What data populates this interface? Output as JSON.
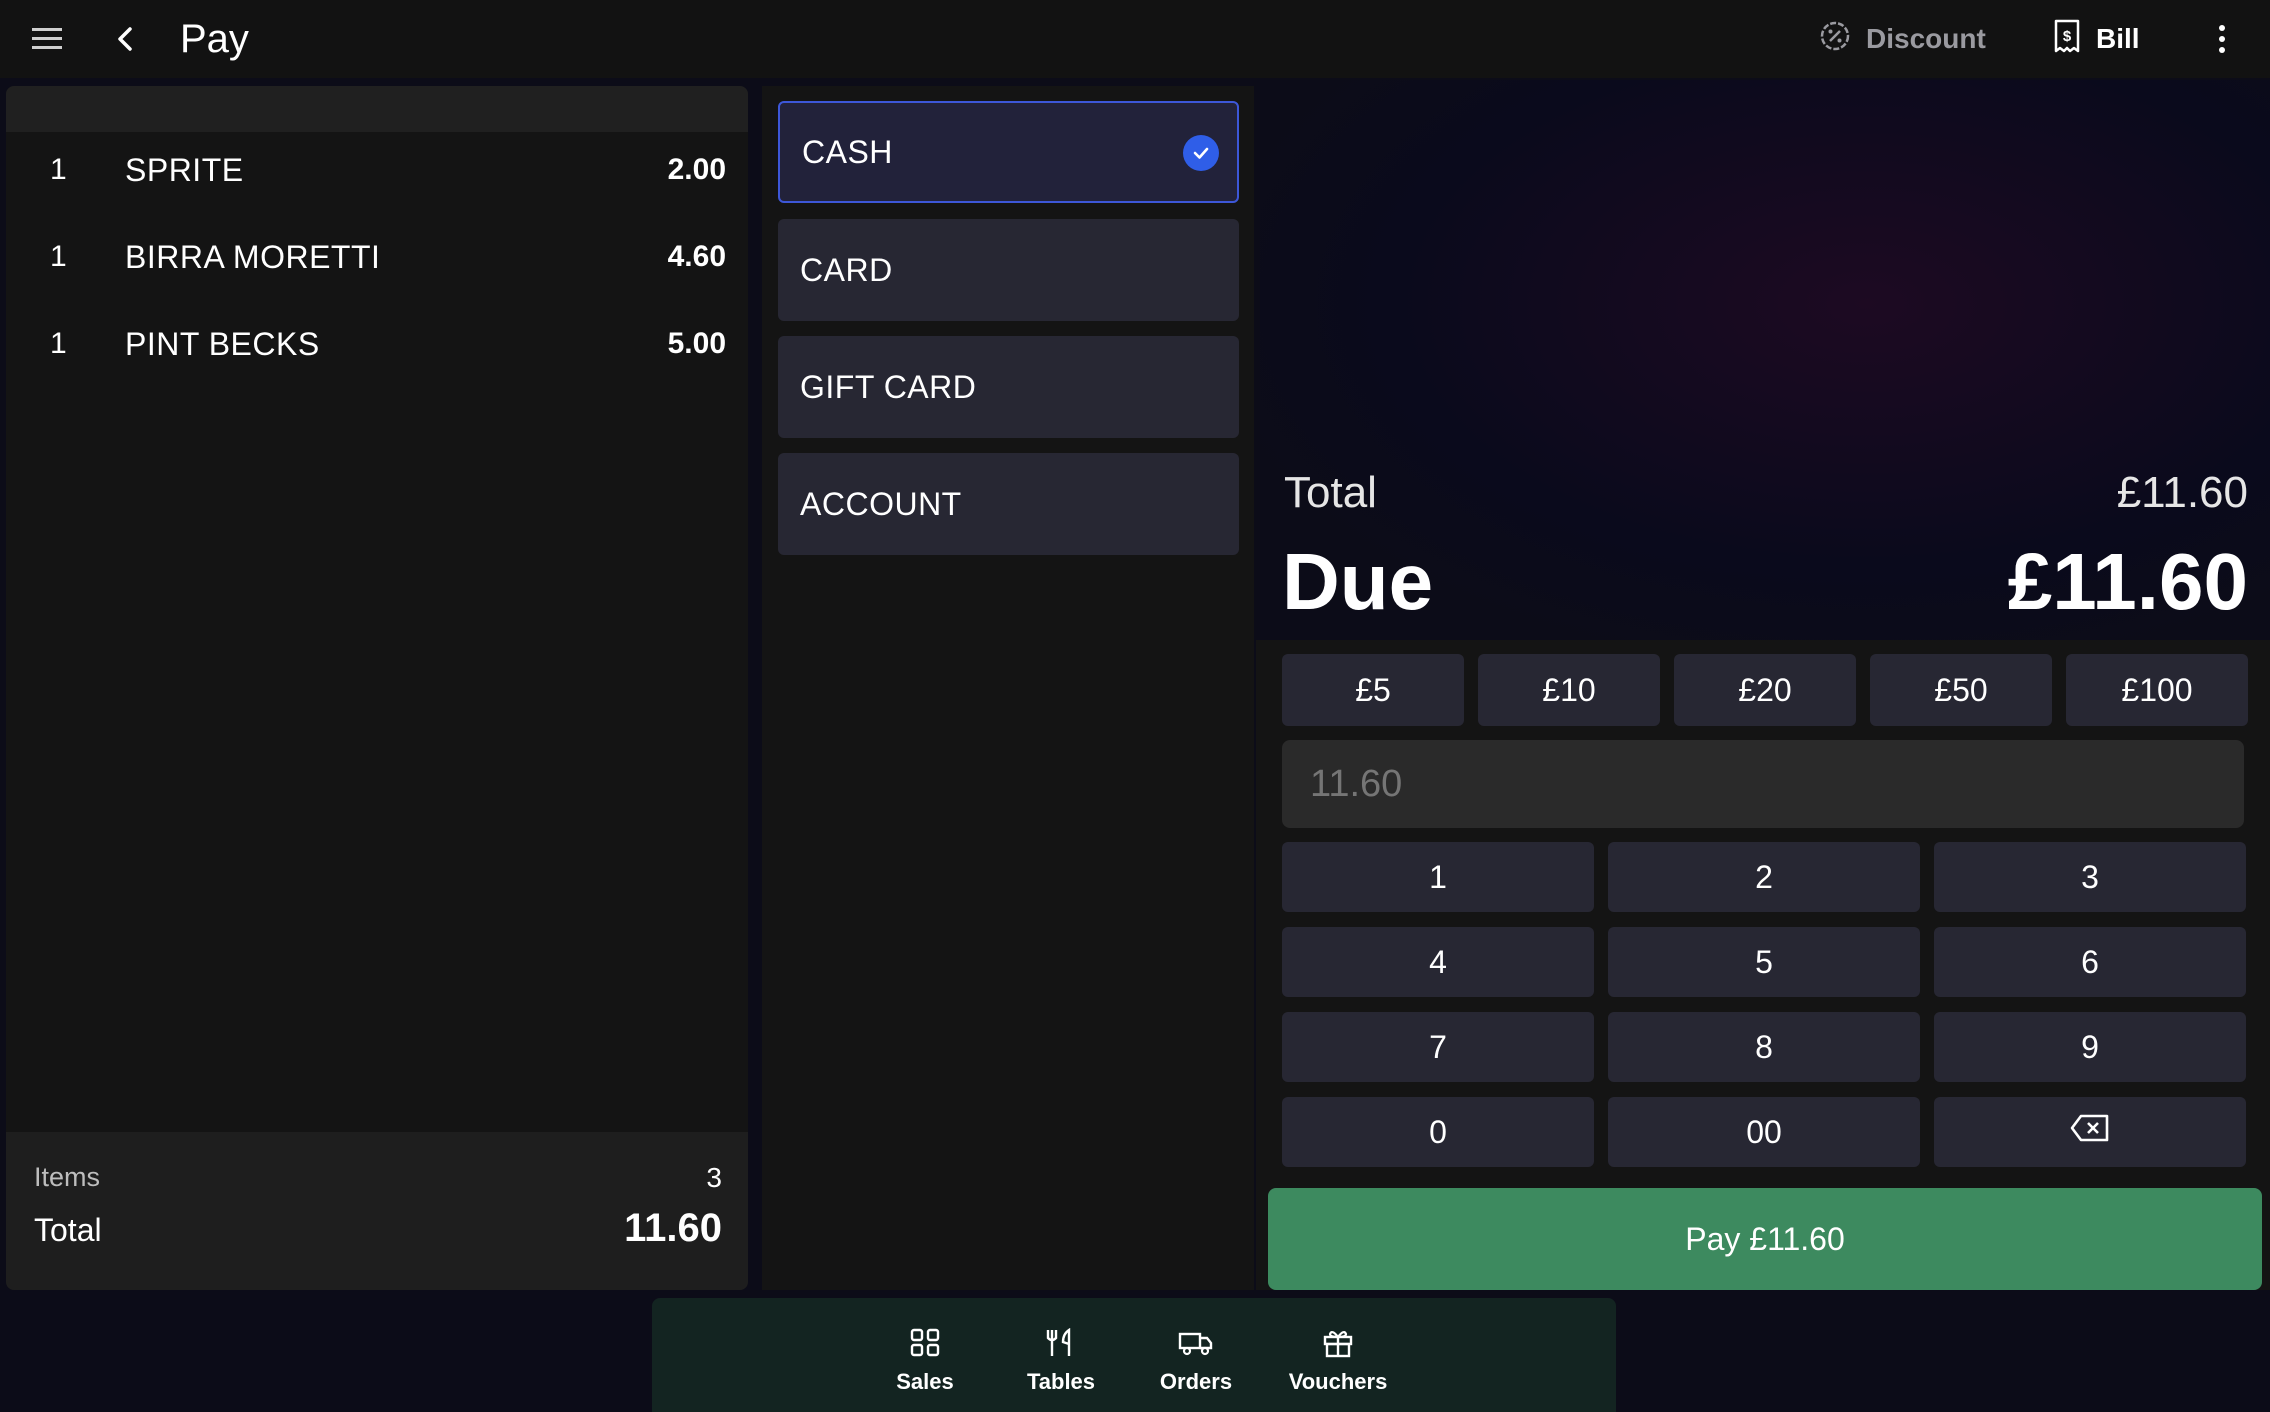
{
  "header": {
    "title": "Pay",
    "discount_label": "Discount",
    "bill_label": "Bill"
  },
  "order": {
    "lines": [
      {
        "qty": "1",
        "name": "SPRITE",
        "price": "2.00"
      },
      {
        "qty": "1",
        "name": "BIRRA MORETTI",
        "price": "4.60"
      },
      {
        "qty": "1",
        "name": "PINT BECKS",
        "price": "5.00"
      }
    ],
    "items_label": "Items",
    "items_count": "3",
    "total_label": "Total",
    "total_value": "11.60"
  },
  "payment_methods": [
    {
      "label": "CASH",
      "selected": true
    },
    {
      "label": "CARD",
      "selected": false
    },
    {
      "label": "GIFT CARD",
      "selected": false
    },
    {
      "label": "ACCOUNT",
      "selected": false
    }
  ],
  "summary": {
    "total_label": "Total",
    "total_value": "£11.60",
    "due_label": "Due",
    "due_value": "£11.60"
  },
  "quick_amounts": [
    "£5",
    "£10",
    "£20",
    "£50",
    "£100"
  ],
  "amount_input": {
    "placeholder": "11.60",
    "value": ""
  },
  "keypad": [
    "1",
    "2",
    "3",
    "4",
    "5",
    "6",
    "7",
    "8",
    "9",
    "0",
    "00"
  ],
  "pay_button_label": "Pay £11.60",
  "bottom_nav": [
    {
      "label": "Sales",
      "icon": "grid-icon"
    },
    {
      "label": "Tables",
      "icon": "cutlery-icon"
    },
    {
      "label": "Orders",
      "icon": "delivery-truck-icon"
    },
    {
      "label": "Vouchers",
      "icon": "gift-icon"
    }
  ],
  "colors": {
    "background": "#0c0c18",
    "panel": "#141414",
    "button": "#272733",
    "selected_border": "#3d57d8",
    "check_blue": "#2f5ee8",
    "pay_green": "#3d8a5f",
    "nav_bg": "#132421"
  }
}
